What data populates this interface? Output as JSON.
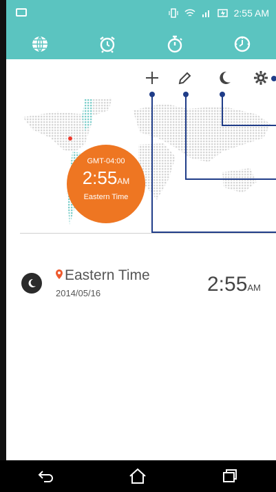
{
  "status_bar": {
    "time": "2:55 AM"
  },
  "tabs": [
    {
      "name": "world-clock"
    },
    {
      "name": "alarm"
    },
    {
      "name": "stopwatch"
    },
    {
      "name": "timer"
    }
  ],
  "current": {
    "gmt": "GMT-04:00",
    "time": "2:55",
    "ampm": "AM",
    "zone": "Eastern Time"
  },
  "list": [
    {
      "city": "Eastern Time",
      "date": "2014/05/16",
      "time": "2:55",
      "ampm": "AM"
    }
  ],
  "colors": {
    "accent": "#5bc4c0",
    "orange": "#ee7622",
    "callout": "#1f3c88"
  }
}
